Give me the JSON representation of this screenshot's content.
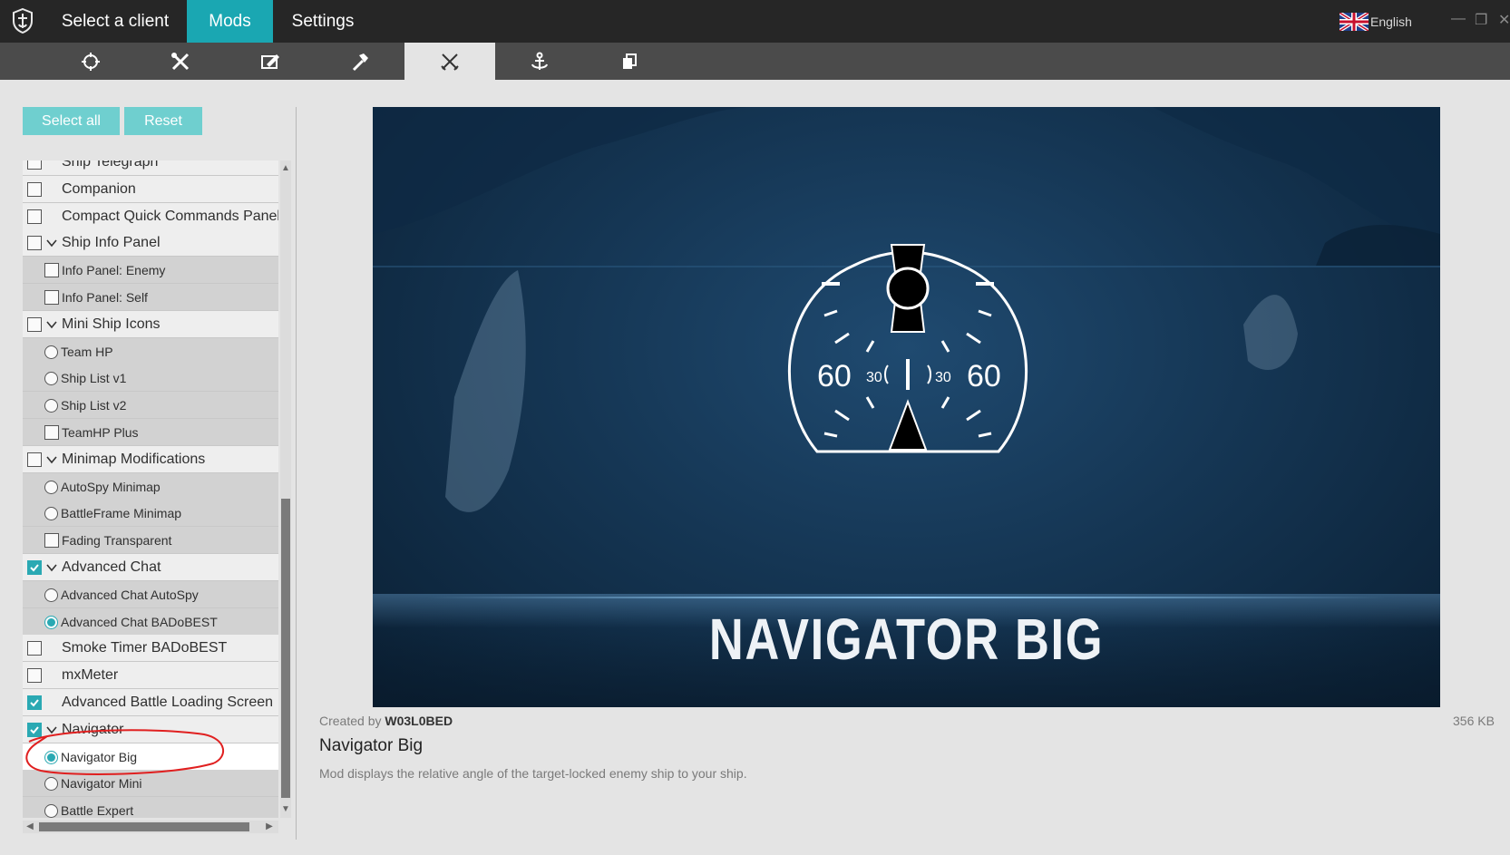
{
  "header": {
    "tabs": [
      {
        "label": "Select a client",
        "active": false
      },
      {
        "label": "Mods",
        "active": true
      },
      {
        "label": "Settings",
        "active": false
      }
    ],
    "language": "English",
    "accent_color": "#1aa7b2"
  },
  "icon_tabs": [
    {
      "icon": "crosshair-icon",
      "active": false
    },
    {
      "icon": "tools-icon",
      "active": false
    },
    {
      "icon": "panel-edit-icon",
      "active": false
    },
    {
      "icon": "hammer-icon",
      "active": false
    },
    {
      "icon": "crossed-swords-icon",
      "active": true
    },
    {
      "icon": "anchor-icon",
      "active": false
    },
    {
      "icon": "copy-icon",
      "active": false
    }
  ],
  "actions": {
    "select_all": "Select all",
    "reset": "Reset"
  },
  "mod_list": [
    {
      "label": "Ship Telegraph",
      "kind": "top",
      "control": "checkbox",
      "checked": false
    },
    {
      "label": "Companion",
      "kind": "top",
      "control": "checkbox",
      "checked": false
    },
    {
      "label": "Compact Quick Commands Panel",
      "kind": "top",
      "control": "checkbox",
      "checked": false
    },
    {
      "label": "Ship Info Panel",
      "kind": "top",
      "control": "checkbox",
      "checked": false,
      "expandable": true
    },
    {
      "label": "Info Panel: Enemy",
      "kind": "sub",
      "control": "checkbox",
      "checked": false
    },
    {
      "label": "Info Panel: Self",
      "kind": "sub",
      "control": "checkbox",
      "checked": false
    },
    {
      "label": "Mini Ship Icons",
      "kind": "top",
      "control": "checkbox",
      "checked": false,
      "expandable": true
    },
    {
      "label": "Team HP",
      "kind": "sub",
      "control": "radio",
      "checked": false
    },
    {
      "label": "Ship List v1",
      "kind": "sub",
      "control": "radio",
      "checked": false
    },
    {
      "label": "Ship List v2",
      "kind": "sub",
      "control": "radio",
      "checked": false
    },
    {
      "label": "TeamHP Plus",
      "kind": "sub",
      "control": "checkbox",
      "checked": false
    },
    {
      "label": "Minimap Modifications",
      "kind": "top",
      "control": "checkbox",
      "checked": false,
      "expandable": true
    },
    {
      "label": "AutoSpy Minimap",
      "kind": "sub",
      "control": "radio",
      "checked": false
    },
    {
      "label": "BattleFrame Minimap",
      "kind": "sub",
      "control": "radio",
      "checked": false
    },
    {
      "label": "Fading Transparent",
      "kind": "sub",
      "control": "checkbox",
      "checked": false
    },
    {
      "label": "Advanced Chat",
      "kind": "top",
      "control": "checkbox",
      "checked": true,
      "expandable": true
    },
    {
      "label": "Advanced Chat AutoSpy",
      "kind": "sub",
      "control": "radio",
      "checked": false
    },
    {
      "label": "Advanced Chat BADoBEST",
      "kind": "sub",
      "control": "radio",
      "checked": true
    },
    {
      "label": "Smoke Timer BADoBEST",
      "kind": "top",
      "control": "checkbox",
      "checked": false
    },
    {
      "label": "mxMeter",
      "kind": "top",
      "control": "checkbox",
      "checked": false
    },
    {
      "label": "Advanced Battle Loading Screen",
      "kind": "top",
      "control": "checkbox",
      "checked": true
    },
    {
      "label": "Navigator",
      "kind": "top",
      "control": "checkbox",
      "checked": true,
      "expandable": true
    },
    {
      "label": "Navigator Big",
      "kind": "sub",
      "control": "radio",
      "checked": true,
      "selected": true
    },
    {
      "label": "Navigator Mini",
      "kind": "sub",
      "control": "radio",
      "checked": false
    },
    {
      "label": "Battle Expert",
      "kind": "sub",
      "control": "radio",
      "checked": false
    }
  ],
  "preview": {
    "title": "NAVIGATOR BIG",
    "gauge_labels": {
      "left_outer": "60",
      "left_inner": "30",
      "right_inner": "30",
      "right_outer": "60"
    }
  },
  "details": {
    "created_prefix": "Created by",
    "author": "W03L0BED",
    "size": "356 KB",
    "name": "Navigator Big",
    "description": "Mod displays the relative angle of the target-locked enemy ship to your ship."
  }
}
